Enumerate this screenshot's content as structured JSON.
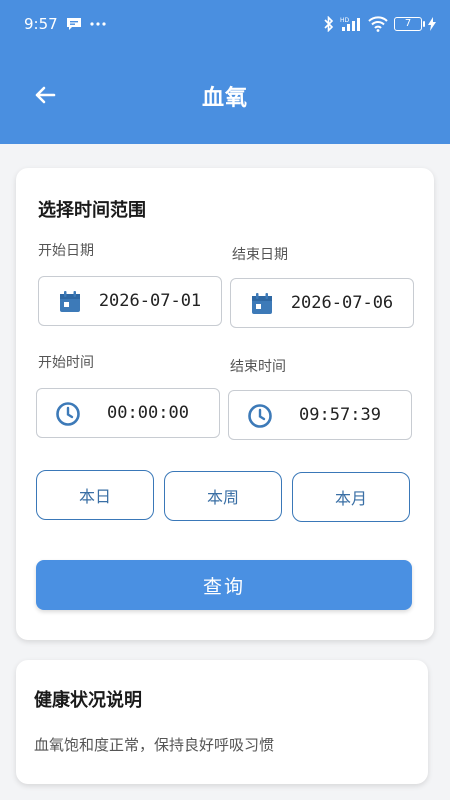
{
  "status_bar": {
    "time": "9:57",
    "battery": "7",
    "hd_label": "HD"
  },
  "app_bar": {
    "title": "血氧"
  },
  "time_range": {
    "section_title": "选择时间范围",
    "start_date_label": "开始日期",
    "start_date": "2026-07-01",
    "end_date_label": "结束日期",
    "end_date": "2026-07-06",
    "start_time_label": "开始时间",
    "start_time": "00:00:00",
    "end_time_label": "结束时间",
    "end_time": "09:57:39",
    "quick_buttons": [
      "本日",
      "本周",
      "本月"
    ],
    "query_label": "查询"
  },
  "health": {
    "section_title": "健康状况说明",
    "description": "血氧饱和度正常，保持良好呼吸习惯"
  },
  "colors": {
    "primary": "#4a8fe0",
    "button_border": "#3a78b8",
    "icon": "#3d7ab8"
  }
}
